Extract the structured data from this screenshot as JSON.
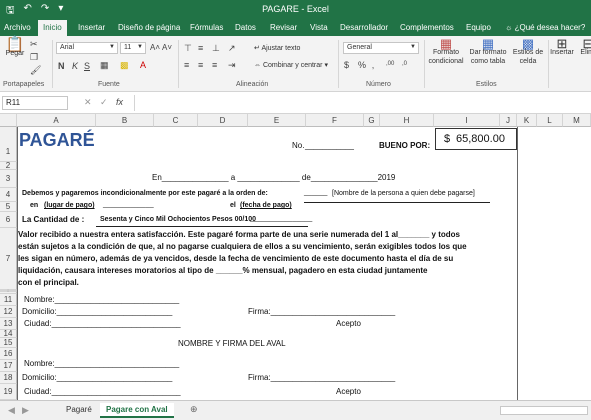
{
  "app": {
    "title": "PAGARE - Excel"
  },
  "ribbon_tabs": [
    "Archivo",
    "Inicio",
    "Insertar",
    "Diseño de página",
    "Fórmulas",
    "Datos",
    "Revisar",
    "Vista",
    "Desarrollador",
    "Complementos",
    "Equipo",
    "¿Qué desea hacer?"
  ],
  "ribbon": {
    "paste": "Pegar",
    "clipboard": "Portapapeles",
    "font_name": "Arial",
    "font_size": "11",
    "font_group": "Fuente",
    "bold": "N",
    "italic": "K",
    "underline": "S",
    "wrap_text": "Ajustar texto",
    "merge_center": "Combinar y centrar",
    "alignment": "Alineación",
    "number_format": "General",
    "number_group": "Número",
    "cond_format": "Formato condicional",
    "format_table": "Dar formato como tabla",
    "cell_styles": "Estilos de celda",
    "styles": "Estilos",
    "insert": "Insertar",
    "delete": "Elimi"
  },
  "formula_bar": {
    "name_box": "R11",
    "formula": "",
    "fx": "fx"
  },
  "columns": [
    "A",
    "B",
    "C",
    "D",
    "E",
    "F",
    "G",
    "H",
    "I",
    "J",
    "K",
    "L",
    "M"
  ],
  "rows": [
    "1",
    "2",
    "3",
    "4",
    "5",
    "6",
    "7",
    "8",
    "9",
    "10",
    "11",
    "12",
    "13",
    "14",
    "15",
    "16",
    "17",
    "18",
    "19"
  ],
  "content": {
    "pagare_title": "PAGARÉ",
    "no_label": "No.",
    "no_blank": "___________",
    "bueno_por": "BUENO POR:",
    "currency": "$",
    "amount": "65,800.00",
    "en_line": "En_______________ a ______________ de_______________2019",
    "debemos": "Debemos y pagaremos incondicionalmente por este pagaré a la orden de:",
    "beneficiario_blank": "______",
    "beneficiario": "[Nombre de la persona a quien debe pagarse]",
    "en_lugar": "en",
    "lugar_pago": "(lugar de pago)",
    "lugar_blank": "_____________",
    "el_label": "el",
    "fecha_pago": "(fecha de pago)",
    "cantidad_label": "La Cantidad de :",
    "cantidad_texto": "Sesenta y Cinco Mil Ochocientos Pesos 00/100",
    "cantidad_blank": "________________",
    "legal_1": "Valor recibido a nuestra entera satisfacción. Este pagaré forma parte de una serie numerada del 1 al_______ y todos",
    "legal_2": "están sujetos a la condición de que, al no pagarse cualquiera de ellos a su vencimiento, serán exigibles todos los que",
    "legal_3": "les sigan en número, además de ya vencidos, desde la fecha de vencimiento de este documento hasta el día de su",
    "legal_4": "liquidación, causara intereses moratorios al tipo de ______% mensual, pagadero en esta ciudad juntamente",
    "legal_5": "con el principal.",
    "nombre": "Nombre:____________________________",
    "domicilio": "Domicilio:__________________________",
    "ciudad": "Ciudad:_____________________________",
    "firma": "Firma:____________________________",
    "acepto": "Acepto",
    "aval_title": "NOMBRE Y FIRMA DEL AVAL",
    "nombre2": "Nombre:____________________________",
    "domicilio2": "Domicilio:__________________________",
    "firma2": "Firma:____________________________",
    "ciudad2": "Ciudad:_____________________________",
    "acepto2": "Acepto"
  },
  "sheet_tabs": [
    "Pagaré",
    "Pagare con Aval"
  ],
  "active_sheet": "Pagare con Aval",
  "colors": {
    "excel_green": "#217346",
    "title_blue": "#2f5496"
  }
}
